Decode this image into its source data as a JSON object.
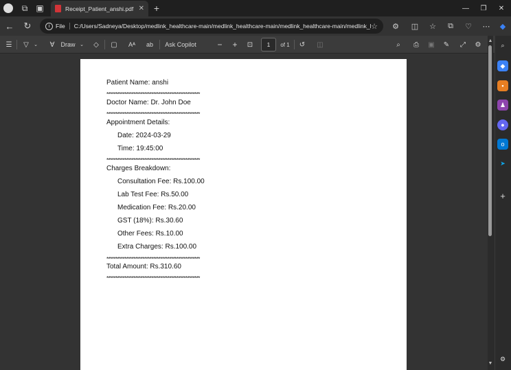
{
  "browser": {
    "tab_title": "Receipt_Patient_anshi.pdf",
    "tab_close": "✕",
    "new_tab": "+",
    "url_scheme_label": "File",
    "url_path": "C:/Users/Sadneya/Desktop/medlink_healthcare-main/medlink_healthcare-main/medlink_healthcare-main/medlink_h...",
    "window_controls": [
      "—",
      "❐",
      "✕"
    ]
  },
  "pdf_toolbar": {
    "draw_label": "Draw",
    "ask_copilot_label": "Ask Copilot",
    "page_current": "1",
    "page_total": "of 1"
  },
  "receipt": {
    "patient_name": "Patient Name: anshi",
    "separator": "****************************************************",
    "doctor_name": "Doctor Name: Dr. John Doe",
    "appointment_heading": "Appointment Details:",
    "date": "Date: 2024-03-29",
    "time": "Time: 19:45:00",
    "charges_heading": "Charges Breakdown:",
    "consultation_fee": "Consultation Fee: Rs.100.00",
    "lab_test_fee": "Lab Test Fee: Rs.50.00",
    "medication_fee": "Medication Fee: Rs.20.00",
    "gst": "GST (18%): Rs.30.60",
    "other_fees": "Other Fees: Rs.10.00",
    "extra_charges": "Extra Charges: Rs.100.00",
    "total_amount": "Total Amount: Rs.310.60"
  },
  "colors": {
    "accent_pdf": "#d13438",
    "sidebar_icons": [
      "#3b82f6",
      "#e67e22",
      "#8e44ad",
      "#6366f1",
      "#0078d4",
      "#0ea5e9"
    ]
  }
}
